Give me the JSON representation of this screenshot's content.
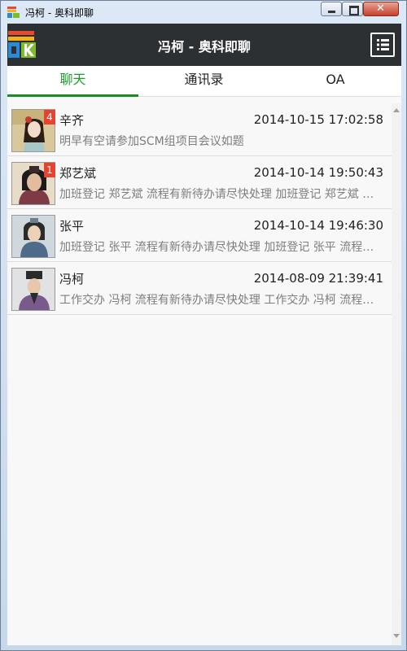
{
  "window": {
    "title": "冯柯 - 奥科即聊"
  },
  "header": {
    "title": "冯柯 - 奥科即聊"
  },
  "tabs": [
    {
      "label": "聊天",
      "active": true
    },
    {
      "label": "通讯录",
      "active": false
    },
    {
      "label": "OA",
      "active": false
    }
  ],
  "chats": [
    {
      "name": "辛齐",
      "time": "2014-10-15 17:02:58",
      "preview": "明早有空请参加SCM组项目会议如题",
      "unread": "4"
    },
    {
      "name": "郑艺斌",
      "time": "2014-10-14 19:50:43",
      "preview": "加班登记 郑艺斌 流程有新待办请尽快处理 加班登记 郑艺斌 流程有新待办请尽快处理",
      "unread": "1"
    },
    {
      "name": "张平",
      "time": "2014-10-14 19:46:30",
      "preview": "加班登记 张平 流程有新待办请尽快处理 加班登记 张平 流程有新待办请尽快处理",
      "unread": ""
    },
    {
      "name": "冯柯",
      "time": "2014-08-09 21:39:41",
      "preview": "工作交办 冯柯 流程有新待办请尽快处理 工作交办 冯柯 流程有新待办请尽快处理",
      "unread": ""
    }
  ],
  "colors": {
    "accent": "#1e9c2a",
    "badge": "#e8412f",
    "header": "#2c3033"
  }
}
